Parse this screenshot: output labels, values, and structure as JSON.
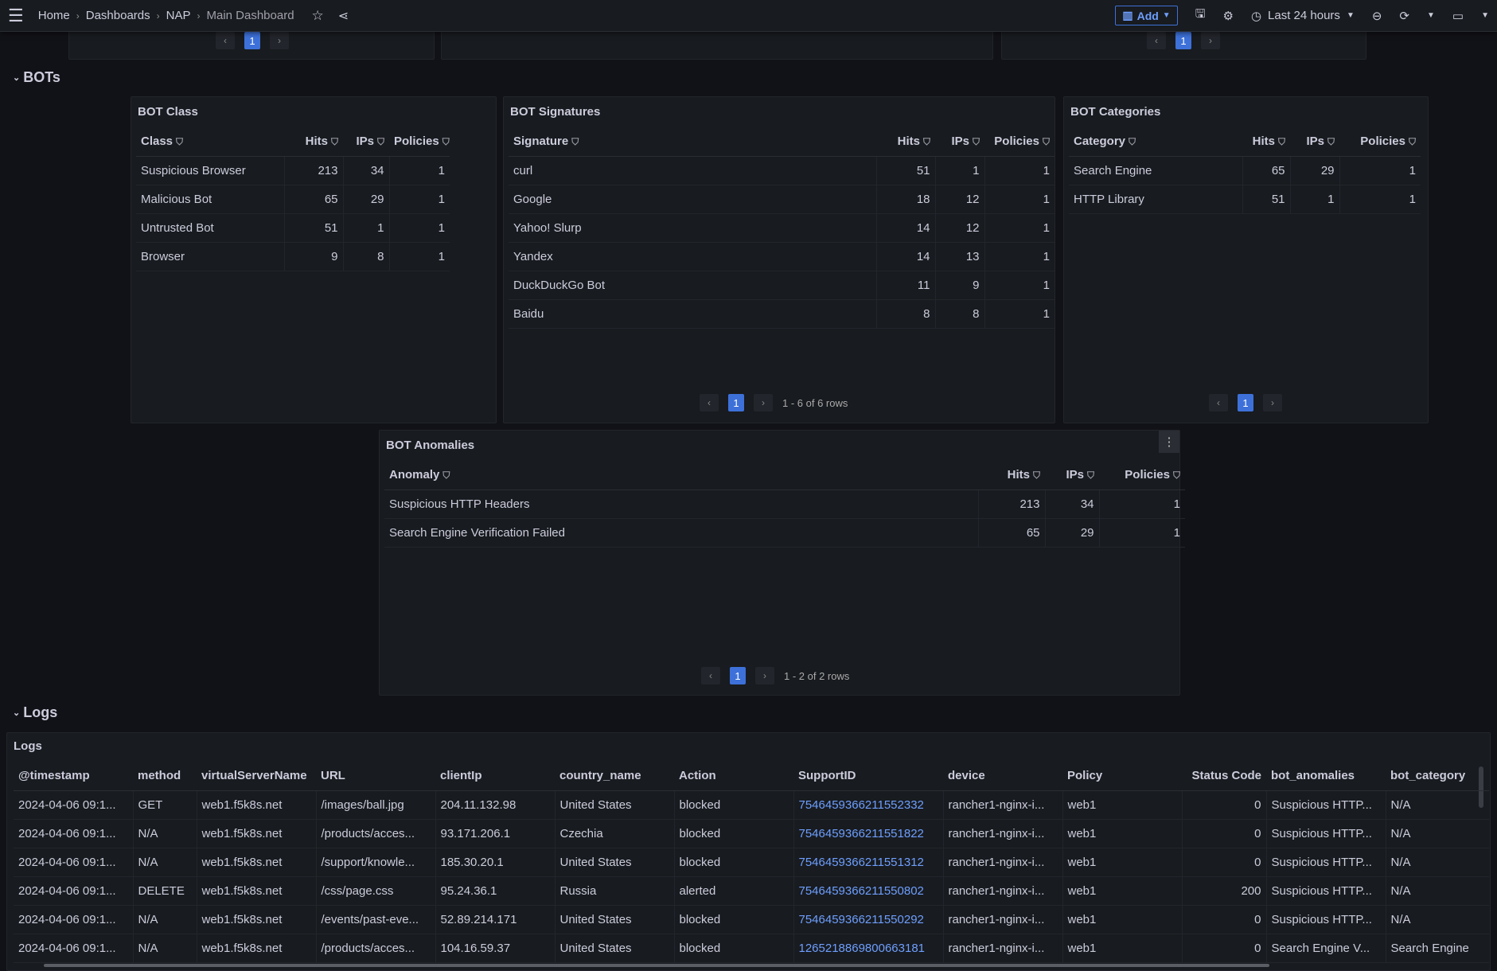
{
  "topbar": {
    "breadcrumb": [
      "Home",
      "Dashboards",
      "NAP",
      "Main Dashboard"
    ],
    "add_label": "Add",
    "time_range": "Last 24 hours"
  },
  "top_pagers": {
    "page": "1"
  },
  "rows": {
    "bots": "BOTs",
    "logs": "Logs"
  },
  "bot_class": {
    "title": "BOT Class",
    "columns": [
      "Class",
      "Hits",
      "IPs",
      "Policies"
    ],
    "rows": [
      [
        "Suspicious Browser",
        "213",
        "34",
        "1"
      ],
      [
        "Malicious Bot",
        "65",
        "29",
        "1"
      ],
      [
        "Untrusted Bot",
        "51",
        "1",
        "1"
      ],
      [
        "Browser",
        "9",
        "8",
        "1"
      ]
    ]
  },
  "bot_signatures": {
    "title": "BOT Signatures",
    "columns": [
      "Signature",
      "Hits",
      "IPs",
      "Policies"
    ],
    "rows": [
      [
        "curl",
        "51",
        "1",
        "1"
      ],
      [
        "Google",
        "18",
        "12",
        "1"
      ],
      [
        "Yahoo! Slurp",
        "14",
        "12",
        "1"
      ],
      [
        "Yandex",
        "14",
        "13",
        "1"
      ],
      [
        "DuckDuckGo Bot",
        "11",
        "9",
        "1"
      ],
      [
        "Baidu",
        "8",
        "8",
        "1"
      ]
    ],
    "page": "1",
    "summary": "1 - 6 of 6 rows"
  },
  "bot_categories": {
    "title": "BOT Categories",
    "columns": [
      "Category",
      "Hits",
      "IPs",
      "Policies"
    ],
    "rows": [
      [
        "Search Engine",
        "65",
        "29",
        "1"
      ],
      [
        "HTTP Library",
        "51",
        "1",
        "1"
      ]
    ],
    "page": "1"
  },
  "bot_anomalies": {
    "title": "BOT Anomalies",
    "columns": [
      "Anomaly",
      "Hits",
      "IPs",
      "Policies"
    ],
    "rows": [
      [
        "Suspicious HTTP Headers",
        "213",
        "34",
        "1"
      ],
      [
        "Search Engine Verification Failed",
        "65",
        "29",
        "1"
      ]
    ],
    "page": "1",
    "summary": "1 - 2 of 2 rows"
  },
  "logs": {
    "title": "Logs",
    "columns": [
      "@timestamp",
      "method",
      "virtualServerName",
      "URL",
      "clientIp",
      "country_name",
      "Action",
      "SupportID",
      "device",
      "Policy",
      "Status Code",
      "bot_anomalies",
      "bot_category"
    ],
    "rows": [
      [
        "2024-04-06 09:1...",
        "GET",
        "web1.f5k8s.net",
        "/images/ball.jpg",
        "204.11.132.98",
        "United States",
        "blocked",
        "7546459366211552332",
        "rancher1-nginx-i...",
        "web1",
        "0",
        "Suspicious HTTP...",
        "N/A"
      ],
      [
        "2024-04-06 09:1...",
        "N/A",
        "web1.f5k8s.net",
        "/products/acces...",
        "93.171.206.1",
        "Czechia",
        "blocked",
        "7546459366211551822",
        "rancher1-nginx-i...",
        "web1",
        "0",
        "Suspicious HTTP...",
        "N/A"
      ],
      [
        "2024-04-06 09:1...",
        "N/A",
        "web1.f5k8s.net",
        "/support/knowle...",
        "185.30.20.1",
        "United States",
        "blocked",
        "7546459366211551312",
        "rancher1-nginx-i...",
        "web1",
        "0",
        "Suspicious HTTP...",
        "N/A"
      ],
      [
        "2024-04-06 09:1...",
        "DELETE",
        "web1.f5k8s.net",
        "/css/page.css",
        "95.24.36.1",
        "Russia",
        "alerted",
        "7546459366211550802",
        "rancher1-nginx-i...",
        "web1",
        "200",
        "Suspicious HTTP...",
        "N/A"
      ],
      [
        "2024-04-06 09:1...",
        "N/A",
        "web1.f5k8s.net",
        "/events/past-eve...",
        "52.89.214.171",
        "United States",
        "blocked",
        "7546459366211550292",
        "rancher1-nginx-i...",
        "web1",
        "0",
        "Suspicious HTTP...",
        "N/A"
      ],
      [
        "2024-04-06 09:1...",
        "N/A",
        "web1.f5k8s.net",
        "/products/acces...",
        "104.16.59.37",
        "United States",
        "blocked",
        "1265218869800663181",
        "rancher1-nginx-i...",
        "web1",
        "0",
        "Search Engine V...",
        "Search Engine"
      ]
    ]
  },
  "colors": {
    "accent": "#3d71d9",
    "link": "#6e9fff",
    "bg": "#111217",
    "panel": "#181b1f"
  }
}
